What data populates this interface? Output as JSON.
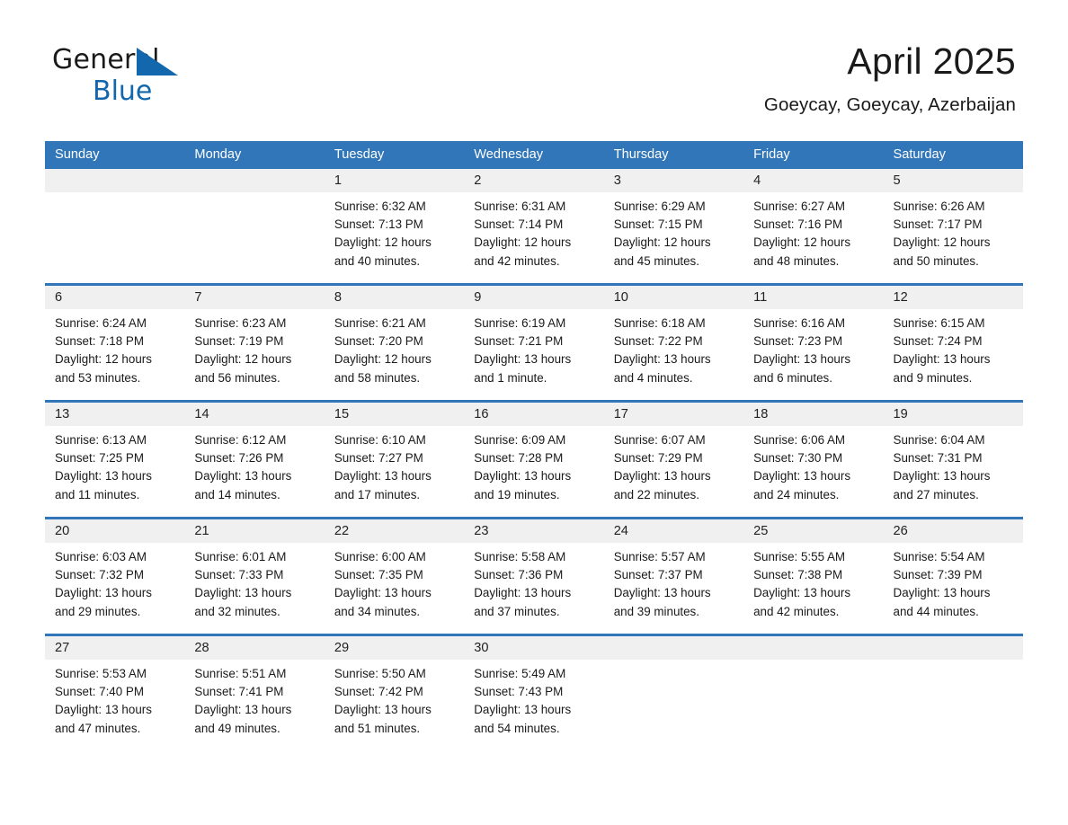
{
  "logo": {
    "text_top": "General",
    "text_bottom": "Blue",
    "triangle_color": "#1368ad",
    "top_color": "#1a1a1a"
  },
  "header": {
    "title": "April 2025",
    "subtitle": "Goeycay, Goeycay, Azerbaijan"
  },
  "colors": {
    "header_blue": "#3176b8",
    "row_rule_blue": "#3176b8",
    "daynum_band": "#f0f0f0",
    "text": "#1a1a1a",
    "header_text": "#ffffff"
  },
  "weekdays": [
    "Sunday",
    "Monday",
    "Tuesday",
    "Wednesday",
    "Thursday",
    "Friday",
    "Saturday"
  ],
  "weeks": [
    [
      {
        "day": "",
        "lines": []
      },
      {
        "day": "",
        "lines": []
      },
      {
        "day": "1",
        "lines": [
          "Sunrise: 6:32 AM",
          "Sunset: 7:13 PM",
          "Daylight: 12 hours",
          "and 40 minutes."
        ]
      },
      {
        "day": "2",
        "lines": [
          "Sunrise: 6:31 AM",
          "Sunset: 7:14 PM",
          "Daylight: 12 hours",
          "and 42 minutes."
        ]
      },
      {
        "day": "3",
        "lines": [
          "Sunrise: 6:29 AM",
          "Sunset: 7:15 PM",
          "Daylight: 12 hours",
          "and 45 minutes."
        ]
      },
      {
        "day": "4",
        "lines": [
          "Sunrise: 6:27 AM",
          "Sunset: 7:16 PM",
          "Daylight: 12 hours",
          "and 48 minutes."
        ]
      },
      {
        "day": "5",
        "lines": [
          "Sunrise: 6:26 AM",
          "Sunset: 7:17 PM",
          "Daylight: 12 hours",
          "and 50 minutes."
        ]
      }
    ],
    [
      {
        "day": "6",
        "lines": [
          "Sunrise: 6:24 AM",
          "Sunset: 7:18 PM",
          "Daylight: 12 hours",
          "and 53 minutes."
        ]
      },
      {
        "day": "7",
        "lines": [
          "Sunrise: 6:23 AM",
          "Sunset: 7:19 PM",
          "Daylight: 12 hours",
          "and 56 minutes."
        ]
      },
      {
        "day": "8",
        "lines": [
          "Sunrise: 6:21 AM",
          "Sunset: 7:20 PM",
          "Daylight: 12 hours",
          "and 58 minutes."
        ]
      },
      {
        "day": "9",
        "lines": [
          "Sunrise: 6:19 AM",
          "Sunset: 7:21 PM",
          "Daylight: 13 hours",
          "and 1 minute."
        ]
      },
      {
        "day": "10",
        "lines": [
          "Sunrise: 6:18 AM",
          "Sunset: 7:22 PM",
          "Daylight: 13 hours",
          "and 4 minutes."
        ]
      },
      {
        "day": "11",
        "lines": [
          "Sunrise: 6:16 AM",
          "Sunset: 7:23 PM",
          "Daylight: 13 hours",
          "and 6 minutes."
        ]
      },
      {
        "day": "12",
        "lines": [
          "Sunrise: 6:15 AM",
          "Sunset: 7:24 PM",
          "Daylight: 13 hours",
          "and 9 minutes."
        ]
      }
    ],
    [
      {
        "day": "13",
        "lines": [
          "Sunrise: 6:13 AM",
          "Sunset: 7:25 PM",
          "Daylight: 13 hours",
          "and 11 minutes."
        ]
      },
      {
        "day": "14",
        "lines": [
          "Sunrise: 6:12 AM",
          "Sunset: 7:26 PM",
          "Daylight: 13 hours",
          "and 14 minutes."
        ]
      },
      {
        "day": "15",
        "lines": [
          "Sunrise: 6:10 AM",
          "Sunset: 7:27 PM",
          "Daylight: 13 hours",
          "and 17 minutes."
        ]
      },
      {
        "day": "16",
        "lines": [
          "Sunrise: 6:09 AM",
          "Sunset: 7:28 PM",
          "Daylight: 13 hours",
          "and 19 minutes."
        ]
      },
      {
        "day": "17",
        "lines": [
          "Sunrise: 6:07 AM",
          "Sunset: 7:29 PM",
          "Daylight: 13 hours",
          "and 22 minutes."
        ]
      },
      {
        "day": "18",
        "lines": [
          "Sunrise: 6:06 AM",
          "Sunset: 7:30 PM",
          "Daylight: 13 hours",
          "and 24 minutes."
        ]
      },
      {
        "day": "19",
        "lines": [
          "Sunrise: 6:04 AM",
          "Sunset: 7:31 PM",
          "Daylight: 13 hours",
          "and 27 minutes."
        ]
      }
    ],
    [
      {
        "day": "20",
        "lines": [
          "Sunrise: 6:03 AM",
          "Sunset: 7:32 PM",
          "Daylight: 13 hours",
          "and 29 minutes."
        ]
      },
      {
        "day": "21",
        "lines": [
          "Sunrise: 6:01 AM",
          "Sunset: 7:33 PM",
          "Daylight: 13 hours",
          "and 32 minutes."
        ]
      },
      {
        "day": "22",
        "lines": [
          "Sunrise: 6:00 AM",
          "Sunset: 7:35 PM",
          "Daylight: 13 hours",
          "and 34 minutes."
        ]
      },
      {
        "day": "23",
        "lines": [
          "Sunrise: 5:58 AM",
          "Sunset: 7:36 PM",
          "Daylight: 13 hours",
          "and 37 minutes."
        ]
      },
      {
        "day": "24",
        "lines": [
          "Sunrise: 5:57 AM",
          "Sunset: 7:37 PM",
          "Daylight: 13 hours",
          "and 39 minutes."
        ]
      },
      {
        "day": "25",
        "lines": [
          "Sunrise: 5:55 AM",
          "Sunset: 7:38 PM",
          "Daylight: 13 hours",
          "and 42 minutes."
        ]
      },
      {
        "day": "26",
        "lines": [
          "Sunrise: 5:54 AM",
          "Sunset: 7:39 PM",
          "Daylight: 13 hours",
          "and 44 minutes."
        ]
      }
    ],
    [
      {
        "day": "27",
        "lines": [
          "Sunrise: 5:53 AM",
          "Sunset: 7:40 PM",
          "Daylight: 13 hours",
          "and 47 minutes."
        ]
      },
      {
        "day": "28",
        "lines": [
          "Sunrise: 5:51 AM",
          "Sunset: 7:41 PM",
          "Daylight: 13 hours",
          "and 49 minutes."
        ]
      },
      {
        "day": "29",
        "lines": [
          "Sunrise: 5:50 AM",
          "Sunset: 7:42 PM",
          "Daylight: 13 hours",
          "and 51 minutes."
        ]
      },
      {
        "day": "30",
        "lines": [
          "Sunrise: 5:49 AM",
          "Sunset: 7:43 PM",
          "Daylight: 13 hours",
          "and 54 minutes."
        ]
      },
      {
        "day": "",
        "lines": []
      },
      {
        "day": "",
        "lines": []
      },
      {
        "day": "",
        "lines": []
      }
    ]
  ]
}
